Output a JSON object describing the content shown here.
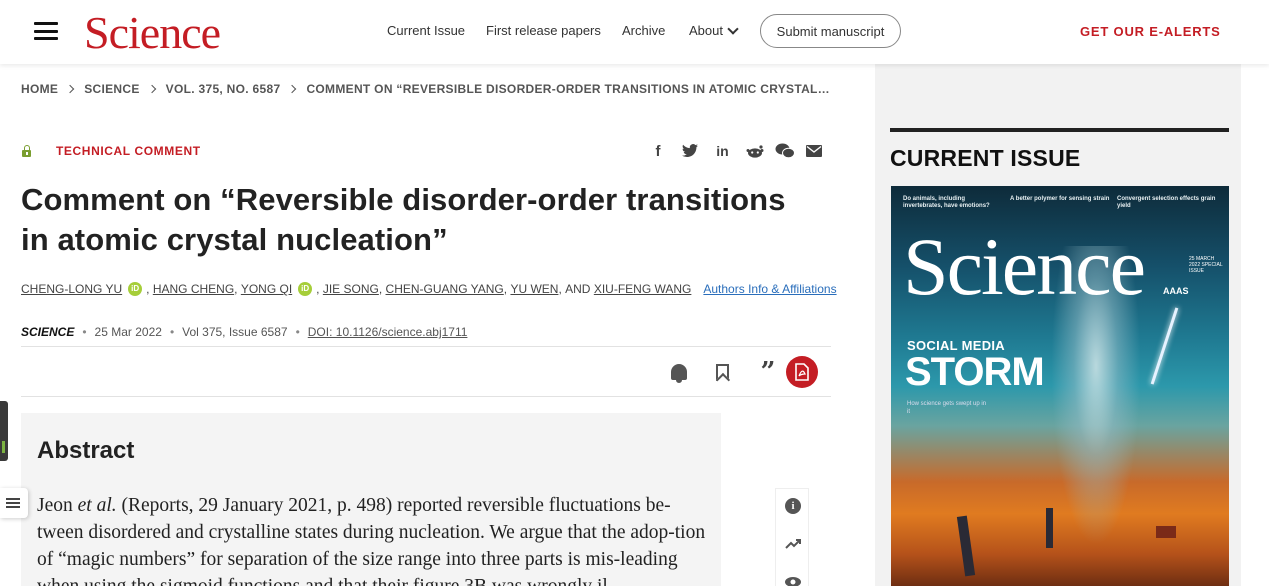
{
  "header": {
    "logo": "Science",
    "nav": {
      "current_issue": "Current Issue",
      "first_release": "First release papers",
      "archive": "Archive",
      "about": "About"
    },
    "submit_label": "Submit manuscript",
    "ealerts_label": "GET OUR E-ALERTS"
  },
  "breadcrumb": {
    "items": [
      "HOME",
      "SCIENCE",
      "VOL. 375, NO. 6587",
      "COMMENT ON “REVERSIBLE DISORDER-ORDER TRANSITIONS IN ATOMIC CRYSTAL…"
    ]
  },
  "article": {
    "type": "TECHNICAL COMMENT",
    "title": "Comment on “Reversible disorder-order transitions in atomic crystal nucleation”",
    "authors": {
      "a1": "CHENG-LONG YU",
      "a2": "HANG CHENG",
      "a3": "YONG QI",
      "a4": "JIE SONG",
      "a5": "CHEN-GUANG YANG",
      "a6": "YU WEN",
      "and": "AND",
      "a7": "XIU-FENG WANG",
      "affiliations_link": "Authors Info & Affiliations"
    },
    "meta": {
      "journal": "SCIENCE",
      "date": "25 Mar 2022",
      "volume": "Vol 375, Issue 6587",
      "doi": "DOI: 10.1126/science.abj1711"
    },
    "share_icons": [
      "facebook-icon",
      "twitter-icon",
      "linkedin-icon",
      "reddit-icon",
      "wechat-icon",
      "email-icon"
    ],
    "toolbar_icons": [
      "bell-icon",
      "bookmark-icon",
      "cite-quote-icon",
      "pdf-icon"
    ]
  },
  "abstract": {
    "heading": "Abstract",
    "author_prefix": "Jeon ",
    "et_al": "et al.",
    "text": " (Reports, 29 January 2021, p. 498) reported reversible fluctuations be-tween disordered and crystalline states during nucleation. We argue that the adop-tion of “magic numbers” for separation of the size range into three parts is mis-leading when using the sigmoid functions and that their figure 3B was wrongly il-"
  },
  "rail": {
    "heading": "CURRENT ISSUE",
    "cover": {
      "teaser1": "Do animals, including invertebrates, have emotions?",
      "teaser2": "A better polymer for sensing strain",
      "teaser3": "Convergent selection effects grain yield",
      "logo": "Science",
      "issue": "25 MARCH 2022 SPECIAL ISSUE",
      "publisher": "AAAS",
      "headline1": "SOCIAL MEDIA",
      "headline2": "STORM",
      "subline": "How science gets swept up in it"
    }
  }
}
